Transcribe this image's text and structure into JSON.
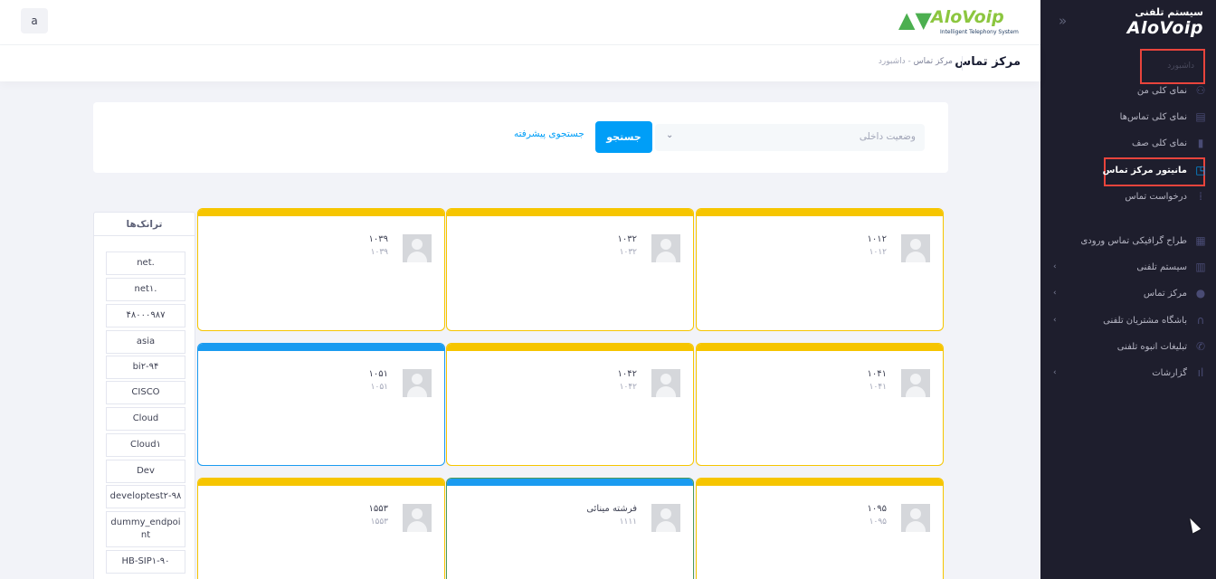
{
  "sidebar": {
    "logo_sub": "سیستم تلفنی",
    "logo_main": "AloVoip",
    "collapse_icon": "double-chevron-icon",
    "section_title": "داشبورد",
    "items": [
      {
        "label": "نمای کلی من",
        "icon": "user-group-icon"
      },
      {
        "label": "نمای کلی تماس‌ها",
        "icon": "phone-book-icon"
      },
      {
        "label": "نمای کلی صف",
        "icon": "queue-icon"
      },
      {
        "label": "مانیتور مرکز تماس",
        "icon": "monitor-icon",
        "active": true
      },
      {
        "label": "درخواست تماس",
        "icon": "grid-icon"
      },
      {
        "label": "طراح گرافیکی تماس ورودی",
        "icon": "flowchart-icon"
      },
      {
        "label": "سیستم تلفنی",
        "icon": "pbx-icon"
      },
      {
        "label": "مرکز تماس",
        "icon": "agent-icon"
      },
      {
        "label": "باشگاه مشتریان تلفنی",
        "icon": "headset-icon"
      },
      {
        "label": "تبلیغات انبوه تلفنی",
        "icon": "phone-icon"
      },
      {
        "label": "گزارشات",
        "icon": "bar-chart-icon"
      }
    ]
  },
  "header": {
    "user_initial": "a",
    "logo_brand": "AloVoip",
    "logo_tagline": "Intelligent Telephony System",
    "page_title": "مرکز تماس",
    "breadcrumb_home": "داشبورد",
    "breadcrumb_sep": "-",
    "breadcrumb_current": "مرکز تماس"
  },
  "search": {
    "status_placeholder": "وضعیت داخلی",
    "search_button": "جستجو",
    "advanced_link": "جستجوی پیشرفته"
  },
  "trunks": {
    "title": "ترانک‌ها",
    "items": [
      "net.",
      "net۱.",
      "۴۸۰۰۰۹۸۷",
      "asia",
      "bi۲-۹۴",
      "CISCO",
      "Cloud",
      "Cloud۱",
      "Dev",
      "developtest۲-۹۸",
      "dummy_endpoint",
      "HB-SIP۱-۹۰"
    ]
  },
  "agents": [
    {
      "name": "۱۰۱۲",
      "ext": "۱۰۱۲",
      "status_color": "#f6c500"
    },
    {
      "name": "۱۰۳۲",
      "ext": "۱۰۳۲",
      "status_color": "#f6c500"
    },
    {
      "name": "۱۰۳۹",
      "ext": "۱۰۳۹",
      "status_color": "#f6c500"
    },
    {
      "name": "۱۰۴۱",
      "ext": "۱۰۴۱",
      "status_color": "#f6c500"
    },
    {
      "name": "۱۰۴۲",
      "ext": "۱۰۴۲",
      "status_color": "#f6c500"
    },
    {
      "name": "۱۰۵۱",
      "ext": "۱۰۵۱",
      "status_color": "#1a9bf0"
    },
    {
      "name": "۱۰۹۵",
      "ext": "۱۰۹۵",
      "status_color": "#f6c500"
    },
    {
      "name": "فرشته مینائی",
      "ext": "۱۱۱۱",
      "status_color": "#1a9bf0"
    },
    {
      "name": "۱۵۵۳",
      "ext": "۱۵۵۳",
      "status_color": "#f6c500"
    }
  ],
  "colors": {
    "accent": "#009ef7",
    "sidebar_bg": "#1e1e2d",
    "highlight": "#e8443c"
  }
}
